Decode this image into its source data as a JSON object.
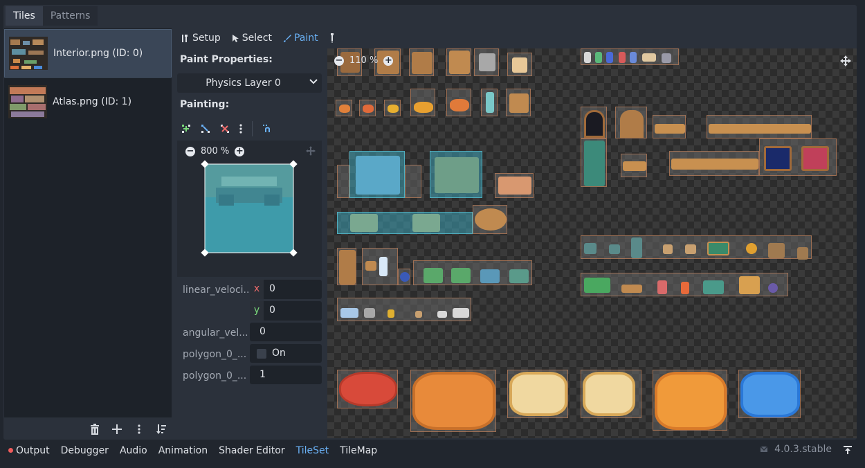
{
  "top_tabs": [
    {
      "label": "Tiles",
      "active": true
    },
    {
      "label": "Patterns",
      "active": false
    }
  ],
  "sources": [
    {
      "label": "Interior.png (ID: 0)",
      "selected": true
    },
    {
      "label": "Atlas.png (ID: 1)",
      "selected": false
    }
  ],
  "left_toolbar_icons": [
    "trash-icon",
    "plus-icon",
    "kebab-icon",
    "sort-icon"
  ],
  "modes": [
    {
      "label": "Setup",
      "icon": "wrench-icon",
      "active": false
    },
    {
      "label": "Select",
      "icon": "cursor-icon",
      "active": false
    },
    {
      "label": "Paint",
      "icon": "brush-icon",
      "active": true
    },
    {
      "label": "",
      "icon": "picker-icon",
      "active": false
    }
  ],
  "paint_properties": {
    "title": "Paint Properties:",
    "selected": "Physics Layer 0"
  },
  "painting": {
    "title": "Painting:",
    "tools": [
      "add-point-icon",
      "move-point-icon",
      "remove-point-icon",
      "kebab-icon",
      "snap-icon"
    ],
    "zoom_label": "800 %"
  },
  "properties": [
    {
      "label": "linear_veloci...",
      "x": "0",
      "y": "0"
    },
    {
      "label": "angular_vel...",
      "value": "0"
    },
    {
      "label": "polygon_0_...",
      "checkbox_label": "On"
    },
    {
      "label": "polygon_0_...",
      "value": "1"
    }
  ],
  "atlas": {
    "zoom_label": "110 %"
  },
  "bottom_tabs": [
    {
      "label": "Output",
      "active": false,
      "alert": true
    },
    {
      "label": "Debugger",
      "active": false
    },
    {
      "label": "Audio",
      "active": false
    },
    {
      "label": "Animation",
      "active": false
    },
    {
      "label": "Shader Editor",
      "active": false
    },
    {
      "label": "TileSet",
      "active": true
    },
    {
      "label": "TileMap",
      "active": false
    }
  ],
  "version": "4.0.3.stable",
  "colors": {
    "accent": "#6ab1f5",
    "panel": "#2b313b",
    "background": "#21262e",
    "alert": "#ef5b5b"
  }
}
